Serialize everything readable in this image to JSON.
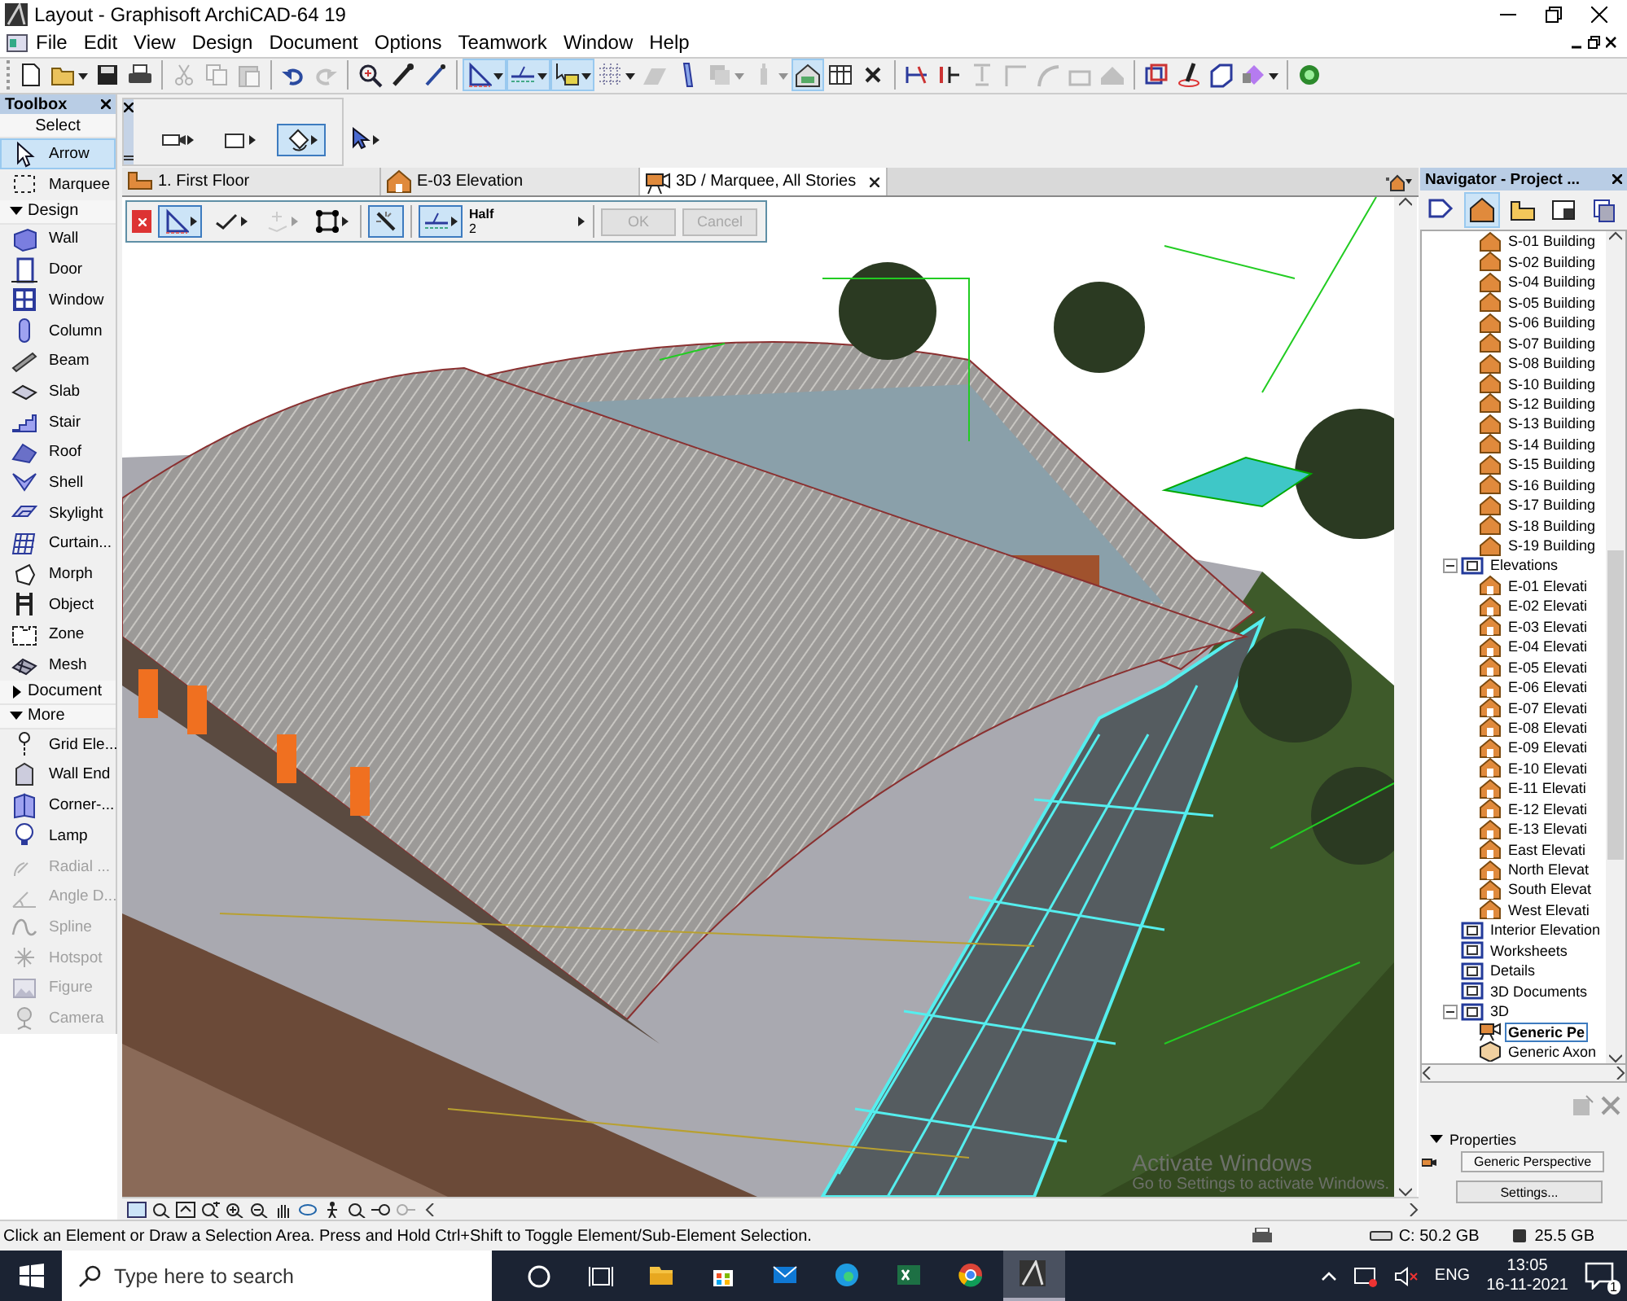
{
  "window": {
    "title": "Layout - Graphisoft ArchiCAD-64 19"
  },
  "menu": [
    "File",
    "Edit",
    "View",
    "Design",
    "Document",
    "Options",
    "Teamwork",
    "Window",
    "Help"
  ],
  "toolbar": {
    "groups": [
      {
        "buttons": [
          {
            "pressed": false,
            "disabled": false,
            "dropdown": false
          },
          {
            "pressed": false,
            "disabled": false,
            "dropdown": true
          },
          {
            "pressed": false,
            "disabled": false,
            "dropdown": false
          },
          {
            "pressed": false,
            "disabled": false,
            "dropdown": false
          }
        ]
      },
      {
        "buttons": [
          {
            "pressed": false,
            "disabled": true,
            "dropdown": false
          },
          {
            "pressed": false,
            "disabled": true,
            "dropdown": false
          },
          {
            "pressed": false,
            "disabled": true,
            "dropdown": false
          }
        ]
      },
      {
        "buttons": [
          {
            "pressed": false,
            "disabled": false,
            "dropdown": false
          },
          {
            "pressed": false,
            "disabled": true,
            "dropdown": false
          }
        ]
      },
      {
        "buttons": [
          {
            "pressed": false,
            "disabled": false,
            "dropdown": false
          },
          {
            "pressed": false,
            "disabled": false,
            "dropdown": false
          },
          {
            "pressed": false,
            "disabled": false,
            "dropdown": false
          }
        ]
      },
      {
        "buttons": [
          {
            "pressed": true,
            "disabled": false,
            "dropdown": true
          },
          {
            "pressed": true,
            "disabled": false,
            "dropdown": true
          },
          {
            "pressed": true,
            "disabled": false,
            "dropdown": true
          },
          {
            "pressed": false,
            "disabled": false,
            "dropdown": true
          },
          {
            "pressed": false,
            "disabled": true,
            "dropdown": false
          },
          {
            "pressed": false,
            "disabled": false,
            "dropdown": false
          },
          {
            "pressed": false,
            "disabled": true,
            "dropdown": true
          },
          {
            "pressed": false,
            "disabled": true,
            "dropdown": true
          },
          {
            "pressed": true,
            "disabled": false,
            "dropdown": false
          },
          {
            "pressed": false,
            "disabled": false,
            "dropdown": false
          },
          {
            "pressed": false,
            "disabled": false,
            "dropdown": false
          }
        ]
      },
      {
        "buttons": [
          {
            "pressed": false,
            "disabled": false,
            "dropdown": false
          },
          {
            "pressed": false,
            "disabled": false,
            "dropdown": false
          },
          {
            "pressed": false,
            "disabled": true,
            "dropdown": false
          },
          {
            "pressed": false,
            "disabled": true,
            "dropdown": false
          },
          {
            "pressed": false,
            "disabled": true,
            "dropdown": false
          },
          {
            "pressed": false,
            "disabled": true,
            "dropdown": false
          },
          {
            "pressed": false,
            "disabled": true,
            "dropdown": false
          }
        ]
      },
      {
        "buttons": [
          {
            "pressed": false,
            "disabled": false,
            "dropdown": false
          },
          {
            "pressed": false,
            "disabled": false,
            "dropdown": false
          },
          {
            "pressed": false,
            "disabled": false,
            "dropdown": false
          },
          {
            "pressed": false,
            "disabled": false,
            "dropdown": true
          }
        ]
      },
      {
        "buttons": [
          {
            "pressed": false,
            "disabled": false,
            "dropdown": false
          }
        ]
      }
    ]
  },
  "palette": {
    "tools": [
      {
        "selected": false
      },
      {
        "selected": false
      },
      {
        "selected": true
      },
      {
        "selected": false
      }
    ]
  },
  "toolbox": {
    "title": "Toolbox",
    "groups": [
      {
        "label": "Select",
        "kind": "plain",
        "expanded": true,
        "items": [
          {
            "label": "Arrow",
            "selected": true,
            "disabled": false
          },
          {
            "label": "Marquee",
            "selected": false,
            "disabled": false
          }
        ]
      },
      {
        "label": "Design",
        "kind": "collapsible",
        "expanded": true,
        "items": [
          {
            "label": "Wall",
            "selected": false,
            "disabled": false
          },
          {
            "label": "Door",
            "selected": false,
            "disabled": false
          },
          {
            "label": "Window",
            "selected": false,
            "disabled": false
          },
          {
            "label": "Column",
            "selected": false,
            "disabled": false
          },
          {
            "label": "Beam",
            "selected": false,
            "disabled": false
          },
          {
            "label": "Slab",
            "selected": false,
            "disabled": false
          },
          {
            "label": "Stair",
            "selected": false,
            "disabled": false
          },
          {
            "label": "Roof",
            "selected": false,
            "disabled": false
          },
          {
            "label": "Shell",
            "selected": false,
            "disabled": false
          },
          {
            "label": "Skylight",
            "selected": false,
            "disabled": false
          },
          {
            "label": "Curtain...",
            "selected": false,
            "disabled": false
          },
          {
            "label": "Morph",
            "selected": false,
            "disabled": false
          },
          {
            "label": "Object",
            "selected": false,
            "disabled": false
          },
          {
            "label": "Zone",
            "selected": false,
            "disabled": false
          },
          {
            "label": "Mesh",
            "selected": false,
            "disabled": false
          }
        ]
      },
      {
        "label": "Document",
        "kind": "collapsible",
        "expanded": false
      },
      {
        "label": "More",
        "kind": "collapsible",
        "expanded": true,
        "items": [
          {
            "label": "Grid Ele...",
            "selected": false,
            "disabled": false
          },
          {
            "label": "Wall End",
            "selected": false,
            "disabled": false
          },
          {
            "label": "Corner-...",
            "selected": false,
            "disabled": false
          },
          {
            "label": "Lamp",
            "selected": false,
            "disabled": false
          },
          {
            "label": "Radial ...",
            "selected": false,
            "disabled": true
          },
          {
            "label": "Angle D...",
            "selected": false,
            "disabled": true
          },
          {
            "label": "Spline",
            "selected": false,
            "disabled": true
          },
          {
            "label": "Hotspot",
            "selected": false,
            "disabled": true
          },
          {
            "label": "Figure",
            "selected": false,
            "disabled": true
          },
          {
            "label": "Camera",
            "selected": false,
            "disabled": true
          }
        ]
      }
    ]
  },
  "tabs": [
    {
      "label": "1. First  Floor",
      "kind": "floor-plan",
      "selected": false
    },
    {
      "label": "E-03 Elevation",
      "kind": "elevation",
      "selected": false
    },
    {
      "label": "3D / Marquee, All Stories",
      "kind": "perspective",
      "selected": true
    }
  ],
  "info_box": {
    "tools": [
      {
        "pressed": true,
        "disabled": false,
        "dropdown": true
      },
      {
        "pressed": false,
        "disabled": false,
        "dropdown": true
      },
      {
        "pressed": false,
        "disabled": true,
        "dropdown": true
      },
      {
        "pressed": false,
        "disabled": false,
        "dropdown": true
      },
      {
        "pressed": true,
        "disabled": false,
        "dropdown": false
      },
      {
        "pressed": true,
        "disabled": false,
        "dropdown": true
      }
    ],
    "option": {
      "label": "Half",
      "value": "2"
    },
    "buttons": [
      {
        "label": "OK",
        "disabled": true
      },
      {
        "label": "Cancel",
        "disabled": true
      }
    ]
  },
  "navigator": {
    "title": "Navigator - Project ...",
    "view_buttons": [
      {
        "selected": false
      },
      {
        "selected": true
      },
      {
        "selected": false
      },
      {
        "selected": false
      },
      {
        "selected": false
      }
    ],
    "tree": [
      {
        "children": [
          {
            "children": [
              {
                "label": "S-01 Building",
                "kind": "section",
                "selected": false
              },
              {
                "label": "S-02 Building",
                "kind": "section",
                "selected": false
              },
              {
                "label": "S-04 Building",
                "kind": "section",
                "selected": false
              },
              {
                "label": "S-05 Building",
                "kind": "section",
                "selected": false
              },
              {
                "label": "S-06 Building",
                "kind": "section",
                "selected": false
              },
              {
                "label": "S-07 Building",
                "kind": "section",
                "selected": false
              },
              {
                "label": "S-08 Building",
                "kind": "section",
                "selected": false
              },
              {
                "label": "S-10 Building",
                "kind": "section",
                "selected": false
              },
              {
                "label": "S-12 Building",
                "kind": "section",
                "selected": false
              },
              {
                "label": "S-13 Building",
                "kind": "section",
                "selected": false
              },
              {
                "label": "S-14 Building",
                "kind": "section",
                "selected": false
              },
              {
                "label": "S-15 Building",
                "kind": "section",
                "selected": false
              },
              {
                "label": "S-16 Building",
                "kind": "section",
                "selected": false
              },
              {
                "label": "S-17 Building",
                "kind": "section",
                "selected": false
              },
              {
                "label": "S-18 Building",
                "kind": "section",
                "selected": false
              },
              {
                "label": "S-19 Building",
                "kind": "section",
                "selected": false
              }
            ]
          },
          {
            "label": "Elevations",
            "kind": "folder",
            "expanded": true,
            "selected": false,
            "children": [
              {
                "label": "E-01 Elevati",
                "kind": "elevation",
                "selected": false
              },
              {
                "label": "E-02 Elevati",
                "kind": "elevation",
                "selected": false
              },
              {
                "label": "E-03 Elevati",
                "kind": "elevation",
                "selected": false
              },
              {
                "label": "E-04 Elevati",
                "kind": "elevation",
                "selected": false
              },
              {
                "label": "E-05 Elevati",
                "kind": "elevation",
                "selected": false
              },
              {
                "label": "E-06 Elevati",
                "kind": "elevation",
                "selected": false
              },
              {
                "label": "E-07 Elevati",
                "kind": "elevation",
                "selected": false
              },
              {
                "label": "E-08 Elevati",
                "kind": "elevation",
                "selected": false
              },
              {
                "label": "E-09 Elevati",
                "kind": "elevation",
                "selected": false
              },
              {
                "label": "E-10 Elevati",
                "kind": "elevation",
                "selected": false
              },
              {
                "label": "E-11 Elevati",
                "kind": "elevation",
                "selected": false
              },
              {
                "label": "E-12 Elevati",
                "kind": "elevation",
                "selected": false
              },
              {
                "label": "E-13 Elevati",
                "kind": "elevation",
                "selected": false
              },
              {
                "label": "East Elevati",
                "kind": "elevation",
                "selected": false
              },
              {
                "label": "North Elevat",
                "kind": "elevation",
                "selected": false
              },
              {
                "label": "South Elevat",
                "kind": "elevation",
                "selected": false
              },
              {
                "label": "West Elevati",
                "kind": "elevation",
                "selected": false
              }
            ]
          },
          {
            "label": "Interior Elevation",
            "kind": "folder",
            "selected": false
          },
          {
            "label": "Worksheets",
            "kind": "folder",
            "selected": false
          },
          {
            "label": "Details",
            "kind": "folder",
            "selected": false
          },
          {
            "label": "3D Documents",
            "kind": "folder",
            "selected": false
          },
          {
            "label": "3D",
            "kind": "folder",
            "expanded": true,
            "selected": false,
            "children": [
              {
                "label": "Generic Pe",
                "kind": "perspective",
                "selected": true
              },
              {
                "label": "Generic Axon",
                "kind": "axonometry",
                "selected": false
              }
            ]
          }
        ]
      }
    ],
    "properties": {
      "label": "Properties",
      "expanded": true,
      "view_name": "Generic Perspective",
      "settings_button": "Settings..."
    }
  },
  "activation_notice": {
    "title": "Activate Windows",
    "text": "Go to Settings to activate Windows."
  },
  "status_bar": {
    "message": "Click an Element or Draw a Selection Area. Press and Hold Ctrl+Shift to Toggle Element/Sub-Element Selection.",
    "disk": "C: 50.2 GB",
    "memory": "25.5 GB"
  },
  "taskbar": {
    "search_placeholder": "Type here to search",
    "apps": [
      {
        "selected": false
      },
      {
        "selected": false
      },
      {
        "selected": false
      },
      {
        "selected": false
      },
      {
        "selected": false
      },
      {
        "selected": false
      },
      {
        "selected": true
      }
    ],
    "language": "ENG",
    "time": "13:05",
    "date": "16-11-2021",
    "notifications": "1"
  }
}
